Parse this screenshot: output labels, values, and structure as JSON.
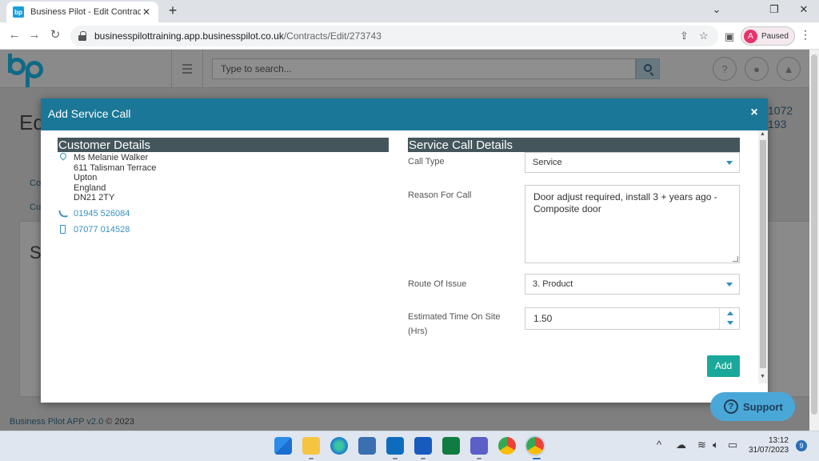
{
  "browser": {
    "tab_title": "Business Pilot - Edit Contract",
    "tab_favicon": "bp",
    "url_host": "businesspilottraining.app.businesspilot.co.uk",
    "url_path": "/Contracts/Edit/273743",
    "profile_initial": "A",
    "profile_label": "Paused"
  },
  "app": {
    "search_placeholder": "Type to search...",
    "help_icon": "?",
    "bg_title": "Ed",
    "bg_side_1": "1072",
    "bg_side_2": "193",
    "bg_link_1": "Co",
    "bg_link_2": "Cu",
    "bg_panel_letter": "S",
    "footer_link": "Business Pilot APP v2.0",
    "footer_copy": "© 2023"
  },
  "modal": {
    "title": "Add Service Call",
    "close_label": "×",
    "customer": {
      "heading": "Customer Details",
      "address_lines": [
        "Ms Melanie Walker",
        "611 Talisman Terrace",
        "Upton",
        "England",
        "DN21 2TY"
      ],
      "phone": "01945 526084",
      "mobile": "07077 014528"
    },
    "service": {
      "heading": "Service Call Details",
      "call_type_label": "Call Type",
      "call_type_value": "Service",
      "reason_label": "Reason For Call",
      "reason_value": "Door adjust required, install 3 + years ago - Composite door",
      "route_label": "Route Of Issue",
      "route_value": "3. Product",
      "time_label_line1": "Estimated Time On Site",
      "time_label_line2": "(Hrs)",
      "time_value": "1.50",
      "add_label": "Add"
    }
  },
  "support": {
    "label": "Support",
    "icon": "?"
  },
  "taskbar": {
    "time": "13:12",
    "date": "31/07/2023",
    "notifications": "9",
    "tray_chevron": "^"
  },
  "colors": {
    "modal_header": "#1a7797",
    "section_bar": "#44565c",
    "add_button": "#1aa89a",
    "link": "#3a8fc0",
    "support": "#4aa8d8"
  }
}
